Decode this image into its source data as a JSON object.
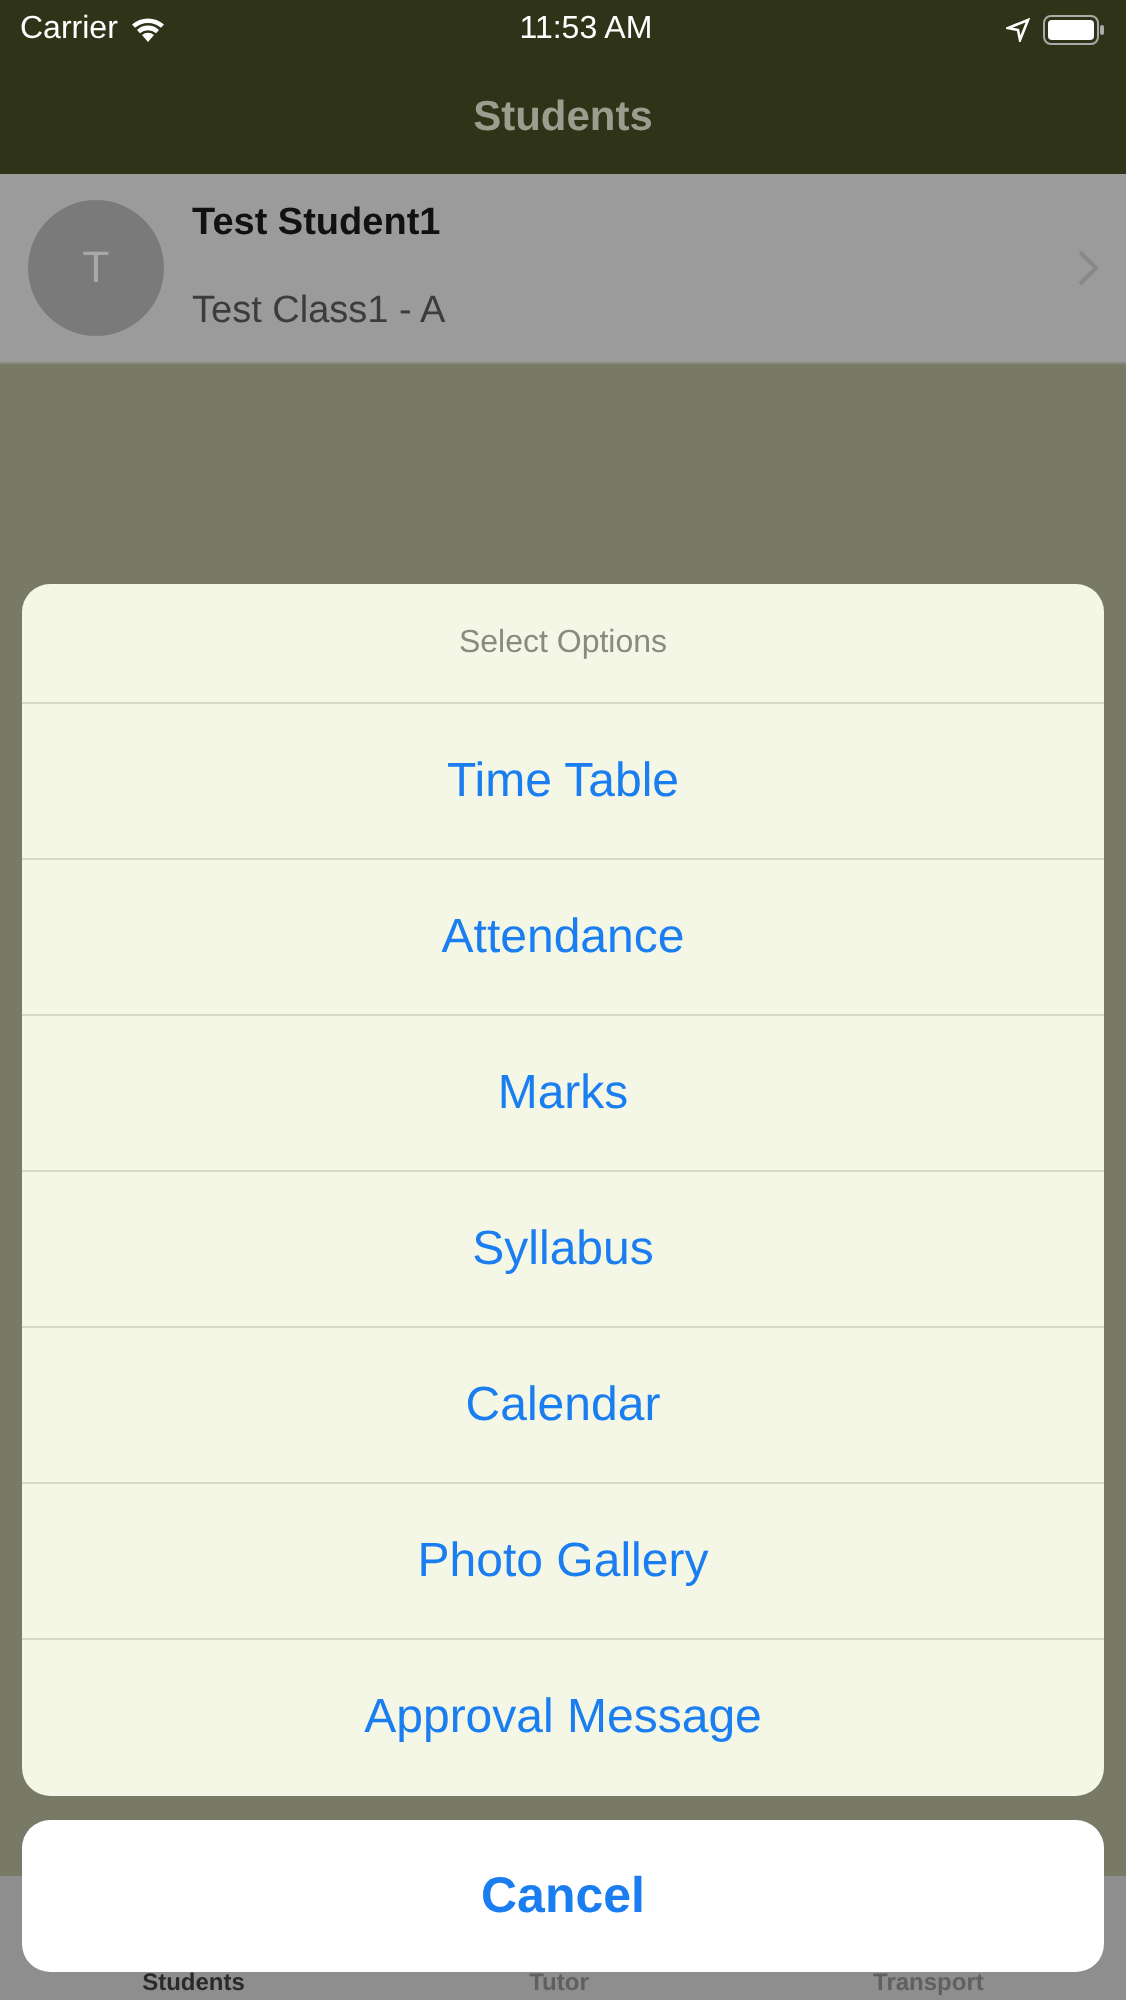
{
  "status_bar": {
    "carrier": "Carrier",
    "time": "11:53 AM"
  },
  "nav_bar": {
    "title": "Students"
  },
  "students": [
    {
      "initial": "T",
      "name": "Test Student1",
      "class": "Test Class1 - A"
    }
  ],
  "tab_bar": [
    {
      "label": "Students",
      "selected": true
    },
    {
      "label": "Tutor",
      "selected": false
    },
    {
      "label": "Transport",
      "selected": false
    }
  ],
  "action_sheet": {
    "title": "Select Options",
    "options": [
      "Time Table",
      "Attendance",
      "Marks",
      "Syllabus",
      "Calendar",
      "Photo Gallery",
      "Approval Message"
    ],
    "cancel": "Cancel"
  }
}
